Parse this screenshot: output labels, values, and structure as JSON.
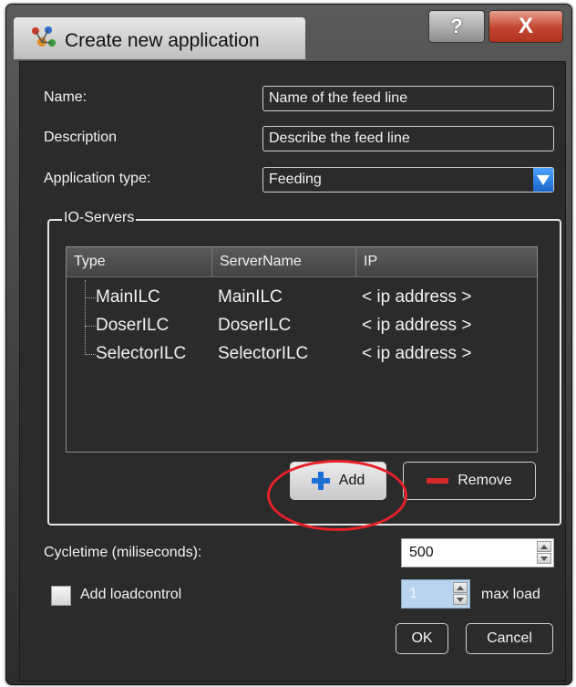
{
  "window": {
    "title": "Create new application",
    "help_label": "?",
    "close_label": "X"
  },
  "form": {
    "name_label": "Name:",
    "name_value": "Name of the feed line",
    "description_label": "Description",
    "description_value": "Describe the feed line",
    "type_label": "Application type:",
    "type_value": "Feeding"
  },
  "io_servers": {
    "group_title": "IO-Servers",
    "columns": [
      "Type",
      "ServerName",
      "IP"
    ],
    "rows": [
      {
        "type": "MainILC",
        "server_name": "MainILC",
        "ip": "< ip address >"
      },
      {
        "type": "DoserILC",
        "server_name": "DoserILC",
        "ip": "< ip address >"
      },
      {
        "type": "SelectorILC",
        "server_name": "SelectorILC",
        "ip": "< ip address >"
      }
    ],
    "add_label": "Add",
    "remove_label": "Remove"
  },
  "cycle": {
    "label": "Cycletime (miliseconds):",
    "value": "500"
  },
  "load": {
    "checkbox_label": "Add loadcontrol",
    "checked": false,
    "value": "1",
    "max_label": "max load"
  },
  "actions": {
    "ok_label": "OK",
    "cancel_label": "Cancel"
  },
  "colors": {
    "highlight": "#e8202a",
    "close": "#c04430",
    "accent": "#1e6fd6"
  }
}
